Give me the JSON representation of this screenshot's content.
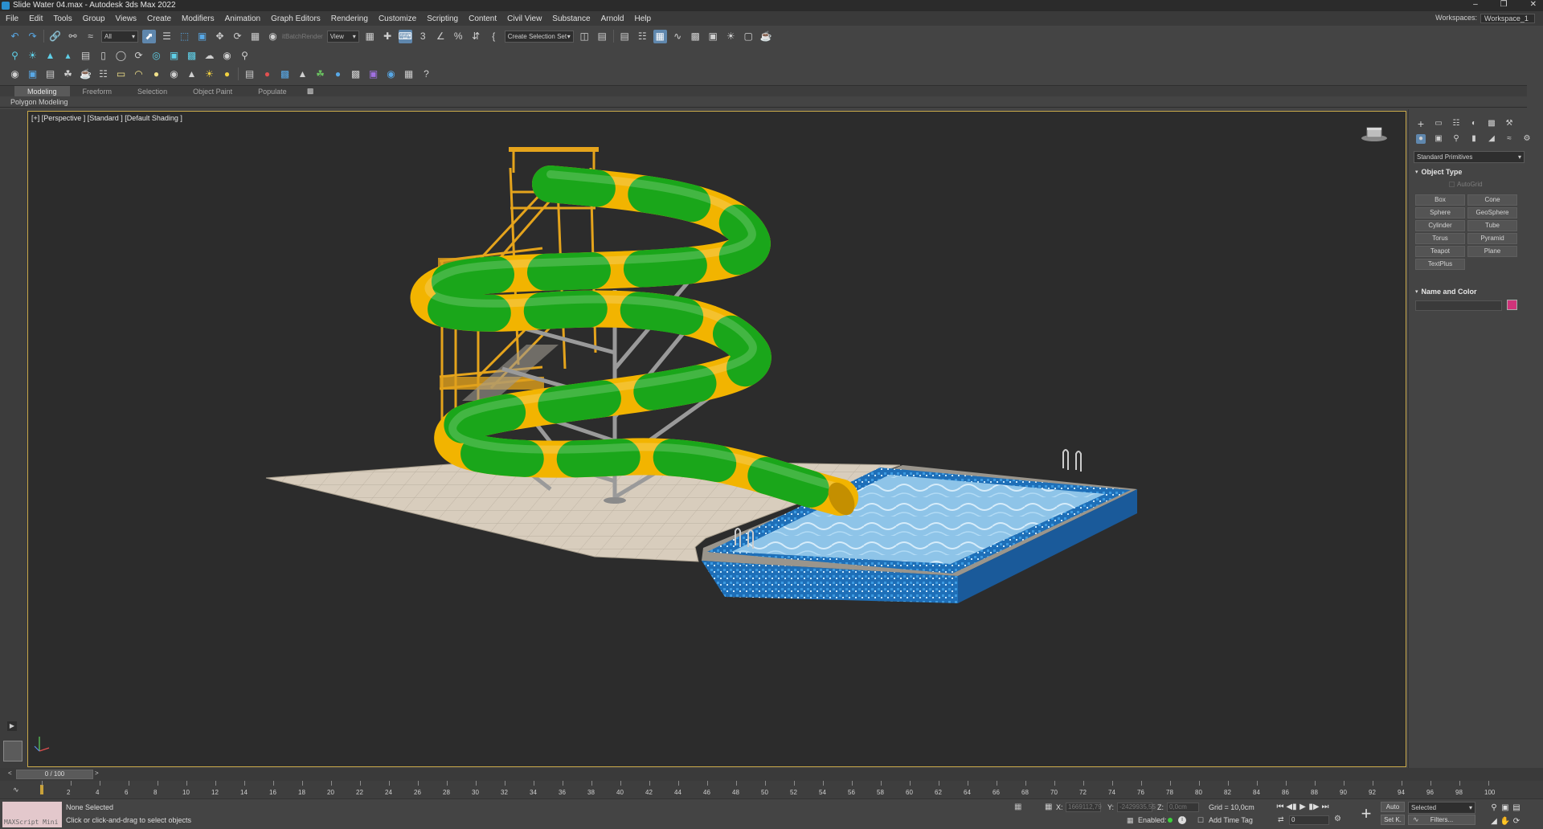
{
  "window": {
    "title": "Slide Water 04.max - Autodesk 3ds Max 2022",
    "minimize": "–",
    "restore": "❐",
    "close": "✕"
  },
  "menu": [
    "File",
    "Edit",
    "Tools",
    "Group",
    "Views",
    "Create",
    "Modifiers",
    "Animation",
    "Graph Editors",
    "Rendering",
    "Customize",
    "Scripting",
    "Content",
    "Civil View",
    "Substance",
    "Arnold",
    "Help"
  ],
  "workspace": {
    "label": "Workspaces:",
    "value": "Workspace_1"
  },
  "toolbar": {
    "filter": "All",
    "batch_render": "itBatchRender",
    "ref_coord": "View",
    "selection_set": "Create Selection Set"
  },
  "ribbon": {
    "tabs": [
      "Modeling",
      "Freeform",
      "Selection",
      "Object Paint",
      "Populate"
    ],
    "active_tab": "Modeling",
    "sub_label": "Polygon Modeling"
  },
  "viewport": {
    "label": "[+] [Perspective ] [Standard ] [Default Shading ]"
  },
  "command_panel": {
    "dropdown": "Standard Primitives",
    "object_type_title": "Object Type",
    "autogrid": "AutoGrid",
    "primitives": [
      "Box",
      "Cone",
      "Sphere",
      "GeoSphere",
      "Cylinder",
      "Tube",
      "Torus",
      "Pyramid",
      "Teapot",
      "Plane",
      "TextPlus"
    ],
    "name_color_title": "Name and Color",
    "object_color": "#d0337a"
  },
  "timeline": {
    "frame_display": "0 / 100",
    "ticks": [
      "0",
      "2",
      "4",
      "6",
      "8",
      "10",
      "12",
      "14",
      "16",
      "18",
      "20",
      "22",
      "24",
      "26",
      "28",
      "30",
      "32",
      "34",
      "36",
      "38",
      "40",
      "42",
      "44",
      "46",
      "48",
      "50",
      "52",
      "54",
      "56",
      "58",
      "60",
      "62",
      "64",
      "66",
      "68",
      "70",
      "72",
      "74",
      "76",
      "78",
      "80",
      "82",
      "84",
      "86",
      "88",
      "90",
      "92",
      "94",
      "96",
      "98",
      "100"
    ]
  },
  "status": {
    "maxscript": "MAXScript Mini",
    "selection": "None Selected",
    "prompt": "Click or click-and-drag to select objects",
    "x_label": "X:",
    "x_value": "1669112,79",
    "y_label": "Y:",
    "y_value": "-2429935,55",
    "z_label": "Z:",
    "z_value": "0,0cm",
    "grid": "Grid = 10,0cm",
    "enabled": "Enabled:",
    "add_time_tag": "Add Time Tag",
    "auto": "Auto",
    "set_key": "Set K.",
    "selected": "Selected",
    "filters": "Filters...",
    "current_frame": "0"
  }
}
